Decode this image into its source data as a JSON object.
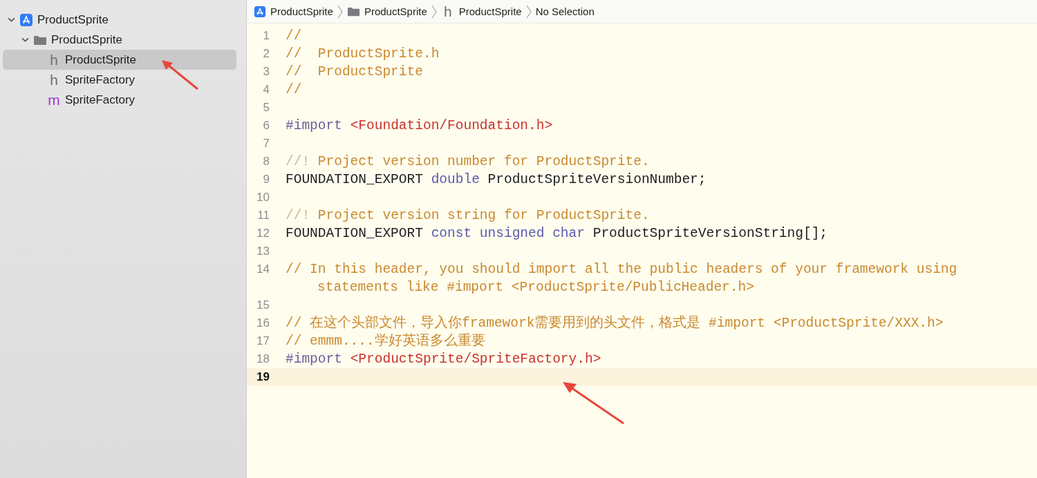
{
  "navigator": {
    "tree": [
      {
        "kind": "project",
        "label": "ProductSprite",
        "expanded": true,
        "selected": false,
        "children": [
          {
            "kind": "folder",
            "label": "ProductSprite",
            "expanded": true,
            "selected": false,
            "children": [
              {
                "kind": "file",
                "badge": "h",
                "color": "#6e6e73",
                "label": "ProductSprite",
                "selected": true
              },
              {
                "kind": "file",
                "badge": "h",
                "color": "#6e6e73",
                "label": "SpriteFactory",
                "selected": false
              },
              {
                "kind": "file",
                "badge": "m",
                "color": "#a033e0",
                "label": "SpriteFactory",
                "selected": false
              }
            ]
          }
        ]
      }
    ]
  },
  "breadcrumb": [
    {
      "kind": "project",
      "label": "ProductSprite"
    },
    {
      "kind": "folder",
      "label": "ProductSprite"
    },
    {
      "kind": "file",
      "badge": "h",
      "label": "ProductSprite"
    },
    {
      "kind": "plain",
      "label": "No Selection"
    }
  ],
  "editor": {
    "lines": [
      {
        "number": "1",
        "current": false,
        "tokens": [
          {
            "kind": "comment",
            "text": "//"
          }
        ]
      },
      {
        "number": "2",
        "current": false,
        "tokens": [
          {
            "kind": "comment",
            "text": "//  ProductSprite.h"
          }
        ]
      },
      {
        "number": "3",
        "current": false,
        "tokens": [
          {
            "kind": "comment",
            "text": "//  ProductSprite"
          }
        ]
      },
      {
        "number": "4",
        "current": false,
        "tokens": [
          {
            "kind": "comment",
            "text": "//"
          }
        ]
      },
      {
        "number": "5",
        "current": false
      },
      {
        "number": "6",
        "current": false,
        "tokens": [
          {
            "kind": "directive",
            "text": "#import "
          },
          {
            "kind": "string",
            "text": "<Foundation/Foundation.h>"
          }
        ]
      },
      {
        "number": "7",
        "current": false
      },
      {
        "number": "8",
        "current": false,
        "tokens": [
          {
            "kind": "docmark",
            "text": "//!"
          },
          {
            "kind": "comment",
            "text": " Project version number for ProductSprite."
          }
        ]
      },
      {
        "number": "9",
        "current": false,
        "tokens": [
          {
            "kind": "plain",
            "text": "FOUNDATION_EXPORT "
          },
          {
            "kind": "keyword",
            "text": "double"
          },
          {
            "kind": "plain",
            "text": " ProductSpriteVersionNumber;"
          }
        ]
      },
      {
        "number": "10",
        "current": false
      },
      {
        "number": "11",
        "current": false,
        "tokens": [
          {
            "kind": "docmark",
            "text": "//!"
          },
          {
            "kind": "comment",
            "text": " Project version string for ProductSprite."
          }
        ]
      },
      {
        "number": "12",
        "current": false,
        "tokens": [
          {
            "kind": "plain",
            "text": "FOUNDATION_EXPORT "
          },
          {
            "kind": "keyword",
            "text": "const unsigned char"
          },
          {
            "kind": "plain",
            "text": " ProductSpriteVersionString[];"
          }
        ]
      },
      {
        "number": "13",
        "current": false
      },
      {
        "number": "14",
        "current": false,
        "tokens": [
          {
            "kind": "comment",
            "text": "// In this header, you should import all the public headers of your framework using"
          }
        ],
        "continuation": [
          {
            "kind": "comment",
            "text": "statements like #import <ProductSprite/PublicHeader.h>"
          }
        ]
      },
      {
        "number": "15",
        "current": false
      },
      {
        "number": "16",
        "current": false,
        "tokens": [
          {
            "kind": "comment",
            "text": "// 在这个头部文件，导入你framework需要用到的头文件，格式是 #import <ProductSprite/XXX.h>"
          }
        ]
      },
      {
        "number": "17",
        "current": false,
        "tokens": [
          {
            "kind": "comment",
            "text": "// emmm....学好英语多么重要"
          }
        ]
      },
      {
        "number": "18",
        "current": false,
        "tokens": [
          {
            "kind": "directive",
            "text": "#import "
          },
          {
            "kind": "string",
            "text": "<ProductSprite/SpriteFactory.h>"
          }
        ]
      },
      {
        "number": "19",
        "current": true
      }
    ]
  }
}
